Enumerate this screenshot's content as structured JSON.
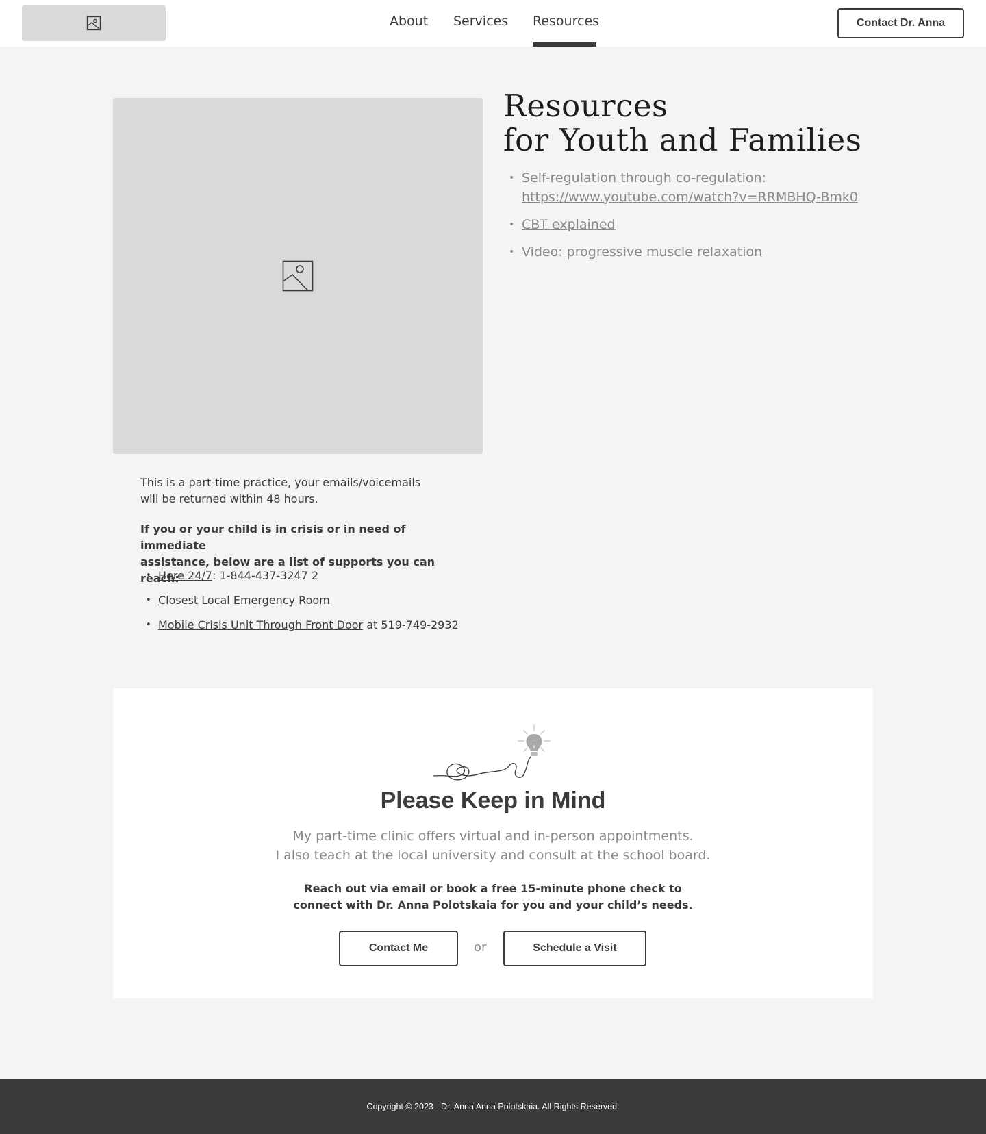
{
  "header": {
    "logo_icon": "image-placeholder-icon",
    "nav": [
      {
        "label": "About"
      },
      {
        "label": "Services"
      },
      {
        "label": "Resources",
        "active": true
      }
    ],
    "cta_label": "Contact Dr. Anna"
  },
  "hero": {
    "image_icon": "image-placeholder-icon"
  },
  "resources": {
    "title_line1": "Resources",
    "title_line2": "for Youth and Families",
    "items": [
      {
        "label": "Self-regulation through co-regulation:",
        "link": "https://www.youtube.com/watch?v=RRMBHQ-Bmk0"
      },
      {
        "link": "CBT explained"
      },
      {
        "link": "Video: progressive muscle relaxation"
      }
    ]
  },
  "practice": {
    "note_line1": "This is a part-time practice, your emails/voicemails",
    "note_line2": "will be returned within 48 hours.",
    "crisis_line1": "If you or your child is in crisis or in need of immediate",
    "crisis_line2": "assistance, below are a list of supports you can reach:",
    "supports": [
      {
        "link": "Here 24/7",
        "suffix": ": 1-844-437-3247 2"
      },
      {
        "link": "Closest Local Emergency Room",
        "suffix": ""
      },
      {
        "link": "Mobile Crisis Unit Through Front Door",
        "suffix": " at 519-749-2932"
      }
    ]
  },
  "keep_in_mind": {
    "illustration": "lightbulb-scribble-icon",
    "title": "Please Keep in Mind",
    "text_line1": "My part-time clinic offers virtual and in-person appointments.",
    "text_line2": "I also teach at the local university and consult at the school board.",
    "cta_line1": "Reach out via email or book a free 15-minute phone check to",
    "cta_line2": "connect with Dr. Anna Polotskaia for you and your child’s needs.",
    "contact_label": "Contact Me",
    "or_label": "or",
    "schedule_label": "Schedule a Visit"
  },
  "footer": {
    "copyright": "Copyright © 2023 - Dr. Anna Anna Polotskaia. All Rights Reserved."
  },
  "colors": {
    "page_bg": "#f4f4f4",
    "dark": "#3c3a3a",
    "muted": "#8a8888",
    "placeholder": "#d9d9d9"
  }
}
